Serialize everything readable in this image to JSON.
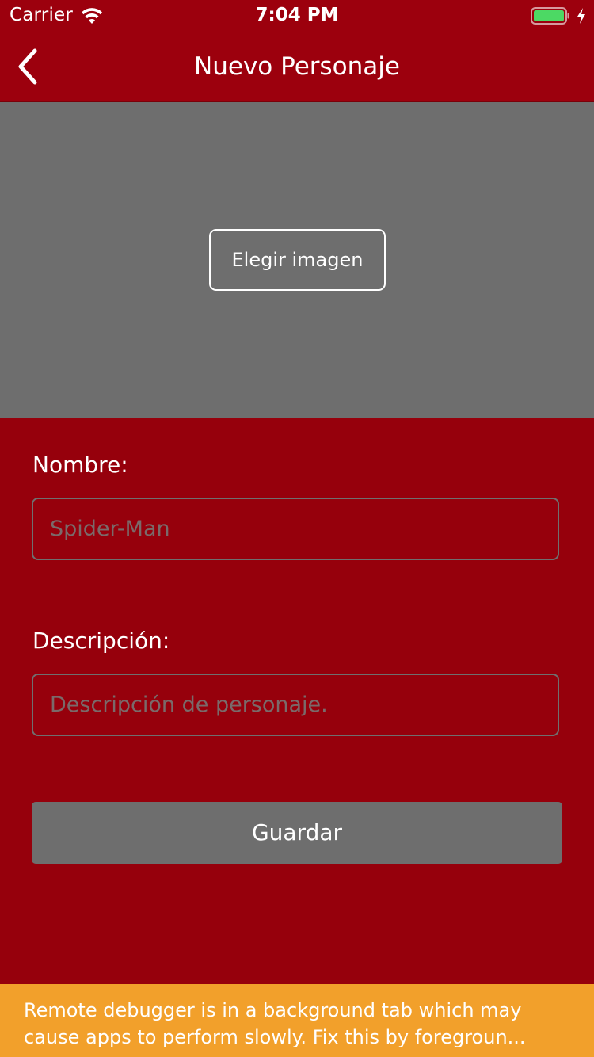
{
  "status_bar": {
    "carrier": "Carrier",
    "time": "7:04 PM",
    "icons": [
      "wifi-icon",
      "battery-icon",
      "charging-bolt-icon"
    ],
    "battery_color": "#4cd964"
  },
  "nav": {
    "title": "Nuevo Personaje",
    "back_icon": "chevron-left-icon"
  },
  "image_picker": {
    "button_label": "Elegir imagen",
    "background_color": "#6e6e6e"
  },
  "form": {
    "name_label": "Nombre:",
    "name_value": "",
    "name_placeholder": "Spider-Man",
    "description_label": "Descripción:",
    "description_value": "",
    "description_placeholder": "Descripción de personaje.",
    "save_label": "Guardar"
  },
  "debug_banner": {
    "line1": "Remote debugger is in a background tab which may",
    "line2": "cause apps to perform slowly. Fix this by foregroun..."
  },
  "colors": {
    "primary": "#96000c",
    "nav_background": "#9c000d",
    "button_gray": "#6e6e6e",
    "banner": "#f2a02b"
  }
}
